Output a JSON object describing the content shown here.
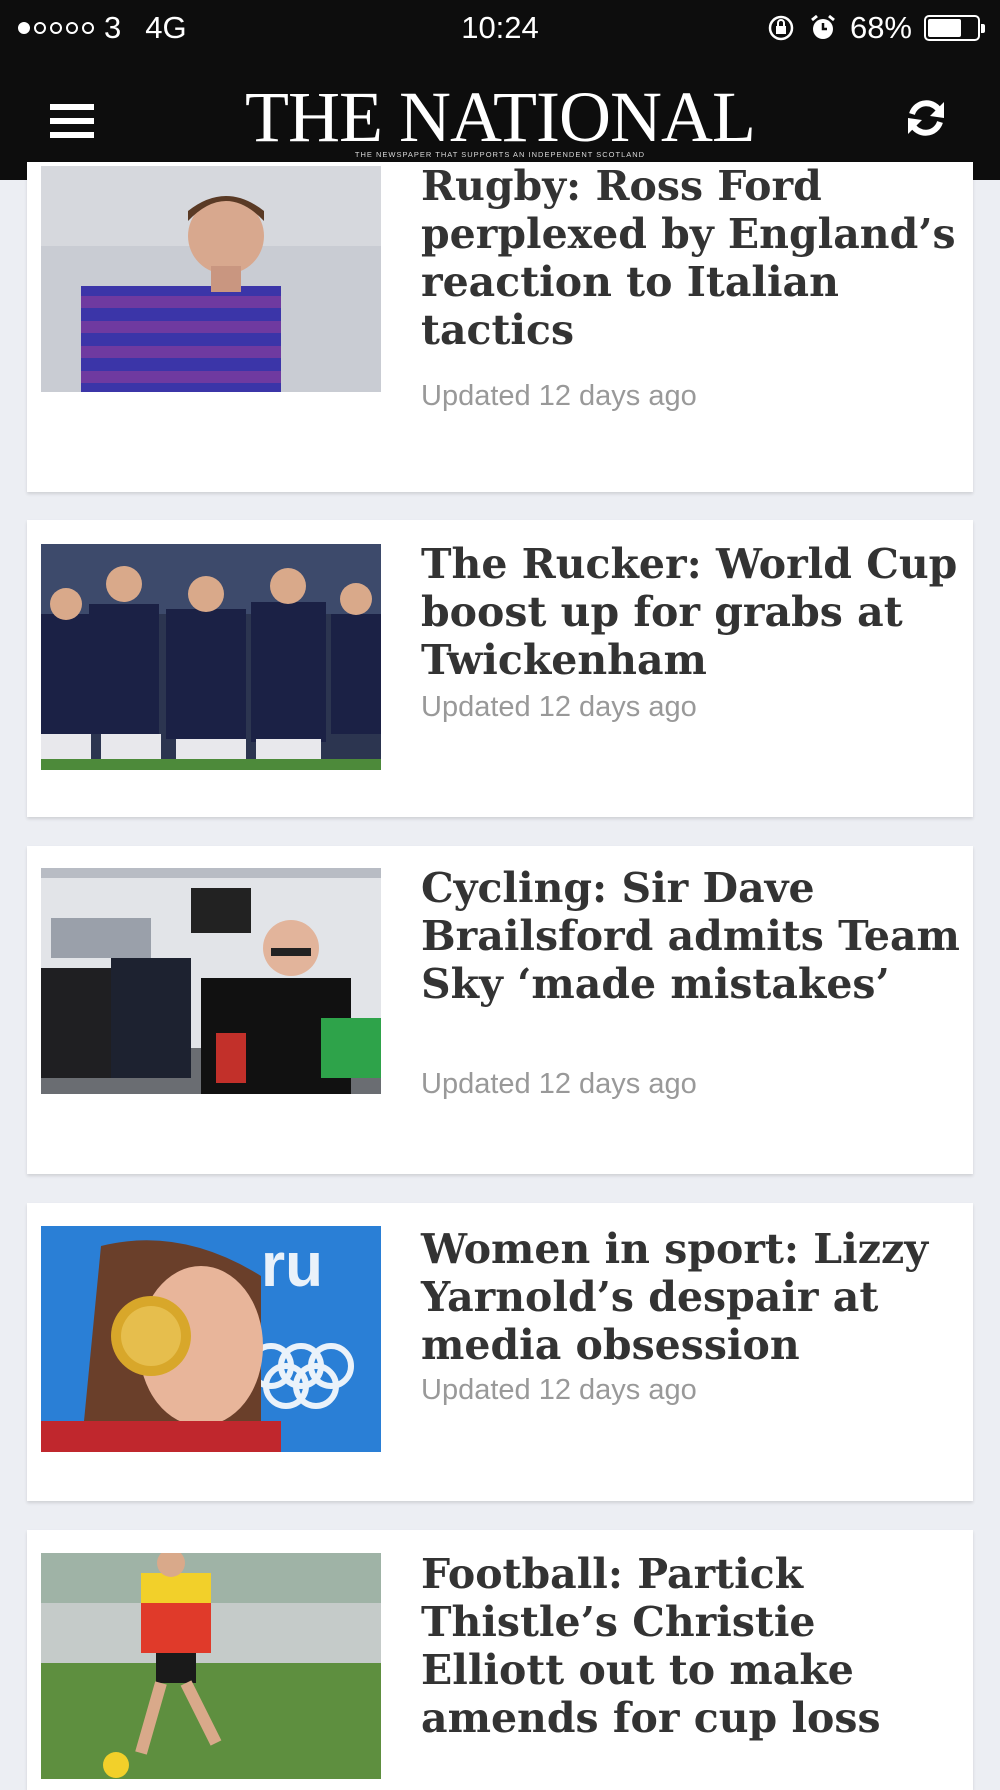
{
  "status_bar": {
    "carrier": "3",
    "network": "4G",
    "time": "10:24",
    "battery": "68%",
    "battery_level": 0.68,
    "signal_bars": 1,
    "icons": [
      "orientation-lock-icon",
      "alarm-icon",
      "battery-icon"
    ]
  },
  "header": {
    "logo": "THE NATIONAL",
    "tagline": "THE NEWSPAPER THAT SUPPORTS AN INDEPENDENT SCOTLAND",
    "left_icon": "hamburger-menu-icon",
    "right_icon": "refresh-icon",
    "background": "#0d0d0d"
  },
  "articles": [
    {
      "title": "Rugby: Ross Ford perplexed by England’s reaction to Italian tactics",
      "updated": "Updated 12 days ago"
    },
    {
      "title": "The Rucker: World Cup boost up for grabs at Twickenham",
      "updated": "Updated 12 days ago"
    },
    {
      "title": "Cycling: Sir Dave Brailsford admits Team Sky ‘made mistakes’",
      "updated": "Updated 12 days ago"
    },
    {
      "title": "Women in sport: Lizzy Yarnold’s despair at media obsession",
      "updated": "Updated 12 days ago"
    },
    {
      "title": "Football: Partick Thistle’s Christie Elliott out to make amends for cup loss",
      "updated": ""
    }
  ],
  "colors": {
    "page_background": "#eceef3",
    "card_background": "#ffffff",
    "headline": "#333333",
    "meta": "#999999"
  }
}
